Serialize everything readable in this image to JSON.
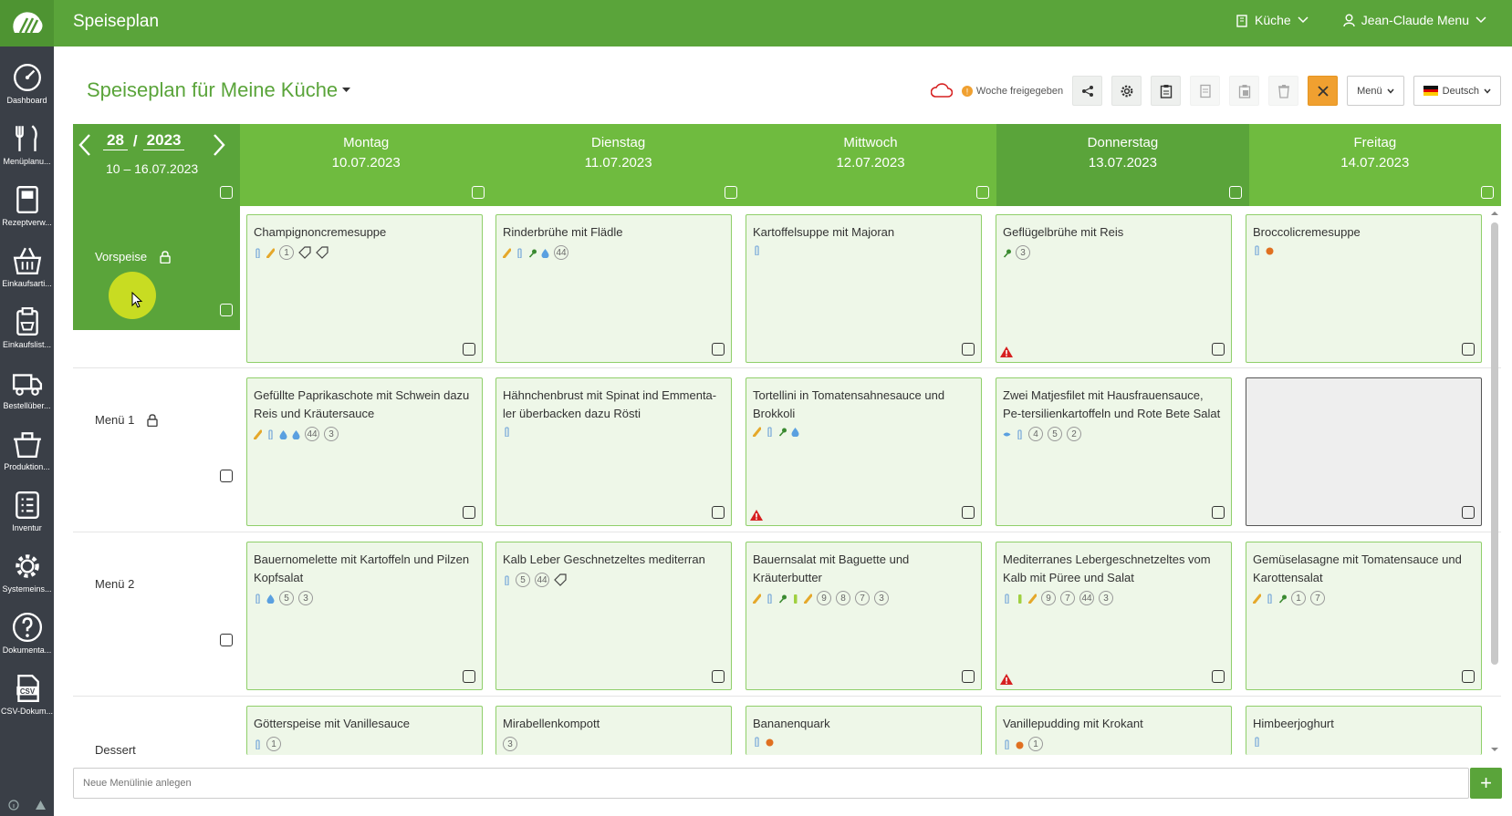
{
  "app": {
    "title": "Speiseplan"
  },
  "top": {
    "kitchen": "Küche",
    "user": "Jean-Claude Menu"
  },
  "sidebar": [
    {
      "label": "Dashboard",
      "icon": "dashboard-icon"
    },
    {
      "label": "Menüplanu...",
      "icon": "fork-knife-icon"
    },
    {
      "label": "Rezeptverw...",
      "icon": "recipe-book-icon"
    },
    {
      "label": "Einkaufsarti...",
      "icon": "basket-icon"
    },
    {
      "label": "Einkaufslist...",
      "icon": "shopping-list-icon"
    },
    {
      "label": "Bestellüber...",
      "icon": "truck-icon"
    },
    {
      "label": "Produktion...",
      "icon": "production-pot-icon"
    },
    {
      "label": "Inventur",
      "icon": "inventory-list-icon"
    },
    {
      "label": "Systemeins...",
      "icon": "gear-icon"
    },
    {
      "label": "Dokumenta...",
      "icon": "help-icon"
    },
    {
      "label": "CSV-Dokum...",
      "icon": "csv-file-icon"
    }
  ],
  "page": {
    "title": "Speiseplan für Meine Küche"
  },
  "toolbar": {
    "co2": "CO2",
    "status": "Woche freigegeben",
    "menu_select": "Menü",
    "language": "Deutsch"
  },
  "week": {
    "number": "28",
    "year": "2023",
    "range": "10 – 16.07.2023"
  },
  "days": [
    {
      "name": "Montag",
      "date": "10.07.2023"
    },
    {
      "name": "Dienstag",
      "date": "11.07.2023"
    },
    {
      "name": "Mittwoch",
      "date": "12.07.2023"
    },
    {
      "name": "Donnerstag",
      "date": "13.07.2023"
    },
    {
      "name": "Freitag",
      "date": "14.07.2023"
    }
  ],
  "rows": [
    {
      "label": "Vorspeise",
      "locked": true,
      "cells": [
        {
          "title": "Champignoncremesuppe",
          "icons": [
            "bottle",
            "wheat"
          ],
          "badges": [
            "1"
          ],
          "tags": 2,
          "warn": false
        },
        {
          "title": "Rinderbrühe mit Flädle",
          "icons": [
            "wheat",
            "bottle",
            "celery",
            "drop"
          ],
          "badges": [
            "44"
          ],
          "tags": 0,
          "warn": false
        },
        {
          "title": "Kartoffelsuppe mit Majoran",
          "icons": [
            "bottle"
          ],
          "badges": [],
          "tags": 0,
          "warn": false
        },
        {
          "title": "Geflügelbrühe mit Reis",
          "icons": [
            "celery"
          ],
          "badges": [
            "3"
          ],
          "tags": 0,
          "warn": true
        },
        {
          "title": "Broccolicremesuppe",
          "icons": [
            "bottle",
            "nut"
          ],
          "badges": [],
          "tags": 0,
          "warn": false
        }
      ]
    },
    {
      "label": "Menü 1",
      "locked": true,
      "cells": [
        {
          "title": "Gefüllte Paprikaschote mit Schwein dazu Reis und Kräutersauce",
          "icons": [
            "wheat",
            "bottle",
            "drop",
            "drop"
          ],
          "badges": [
            "44",
            "3"
          ],
          "tags": 0,
          "warn": false
        },
        {
          "title": "Hähnchenbrust mit Spinat ind Emmenta-ler überbacken dazu Rösti",
          "icons": [
            "bottle"
          ],
          "badges": [],
          "tags": 0,
          "warn": false
        },
        {
          "title": "Tortellini in Tomatensahnesauce und Brokkoli",
          "icons": [
            "wheat",
            "bottle",
            "celery",
            "drop"
          ],
          "badges": [],
          "tags": 0,
          "warn": true
        },
        {
          "title": "Zwei Matjesfilet mit Hausfrauensauce, Pe-tersilienkartoffeln und Rote Bete Salat",
          "icons": [
            "fish",
            "bottle"
          ],
          "badges": [
            "4",
            "5",
            "2"
          ],
          "tags": 0,
          "warn": false
        },
        {
          "title": "",
          "empty": true,
          "icons": [],
          "badges": [],
          "tags": 0,
          "warn": false
        }
      ]
    },
    {
      "label": "Menü 2",
      "locked": false,
      "cells": [
        {
          "title": "Bauernomelette mit Kartoffeln und Pilzen Kopfsalat",
          "icons": [
            "bottle",
            "drop"
          ],
          "badges": [
            "5",
            "3"
          ],
          "tags": 0,
          "warn": false
        },
        {
          "title": "Kalb Leber Geschnetzeltes mediterran",
          "icons": [
            "bottle"
          ],
          "badges": [
            "5",
            "44"
          ],
          "tags": 1,
          "warn": false
        },
        {
          "title": "Bauernsalat mit Baguette und Kräuterbutter",
          "icons": [
            "wheat",
            "bottle",
            "celery",
            "mustard",
            "wheat"
          ],
          "badges": [
            "9",
            "8",
            "7",
            "3"
          ],
          "tags": 0,
          "warn": false
        },
        {
          "title": "Mediterranes Lebergeschnetzeltes vom Kalb mit Püree und Salat",
          "icons": [
            "bottle",
            "mustard",
            "wheat"
          ],
          "badges": [
            "9",
            "7",
            "44",
            "3"
          ],
          "tags": 0,
          "warn": true
        },
        {
          "title": "Gemüselasagne mit Tomatensauce und Karottensalat",
          "icons": [
            "wheat",
            "bottle",
            "celery"
          ],
          "badges": [
            "1",
            "7"
          ],
          "tags": 0,
          "warn": false
        }
      ]
    },
    {
      "label": "Dessert",
      "locked": false,
      "cells": [
        {
          "title": "Götterspeise mit Vanillesauce",
          "icons": [
            "bottle"
          ],
          "badges": [
            "1"
          ],
          "tags": 0,
          "warn": false
        },
        {
          "title": "Mirabellenkompott",
          "icons": [],
          "badges": [
            "3"
          ],
          "tags": 0,
          "warn": false
        },
        {
          "title": "Bananenquark",
          "icons": [
            "bottle",
            "nut"
          ],
          "badges": [],
          "tags": 0,
          "warn": false
        },
        {
          "title": "Vanillepudding mit Krokant",
          "icons": [
            "bottle",
            "nut"
          ],
          "badges": [
            "1"
          ],
          "tags": 0,
          "warn": false
        },
        {
          "title": "Himbeerjoghurt",
          "icons": [
            "bottle"
          ],
          "badges": [],
          "tags": 0,
          "warn": false
        }
      ]
    }
  ],
  "footer": {
    "new_line_placeholder": "Neue Menülinie anlegen",
    "add": "+"
  },
  "colors": {
    "brand": "#5aa43a",
    "header_day": "#6fbb3f",
    "cell_bg": "#eef7e8",
    "warning": "#d62020"
  }
}
